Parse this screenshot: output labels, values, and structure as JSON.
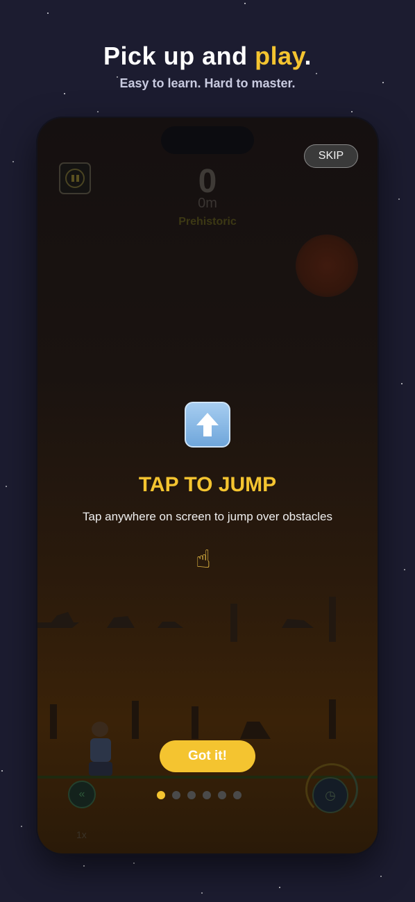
{
  "header": {
    "title_prefix": "Pick up and ",
    "title_accent": "play",
    "title_suffix": ".",
    "subtitle": "Easy to learn. Hard to master."
  },
  "game": {
    "score": "0",
    "distance": "0m",
    "era": "Prehistoric",
    "skip_label": "SKIP",
    "speed_label": "1x"
  },
  "tutorial": {
    "icon": "up-arrow-icon",
    "title": "TAP TO JUMP",
    "text": "Tap anywhere on screen to jump over obstacles",
    "hand_icon": "pointing-hand-icon",
    "button_label": "Got it!",
    "pages": 6,
    "current_page": 1
  },
  "colors": {
    "accent": "#f4c430",
    "background": "#1c1c30"
  }
}
